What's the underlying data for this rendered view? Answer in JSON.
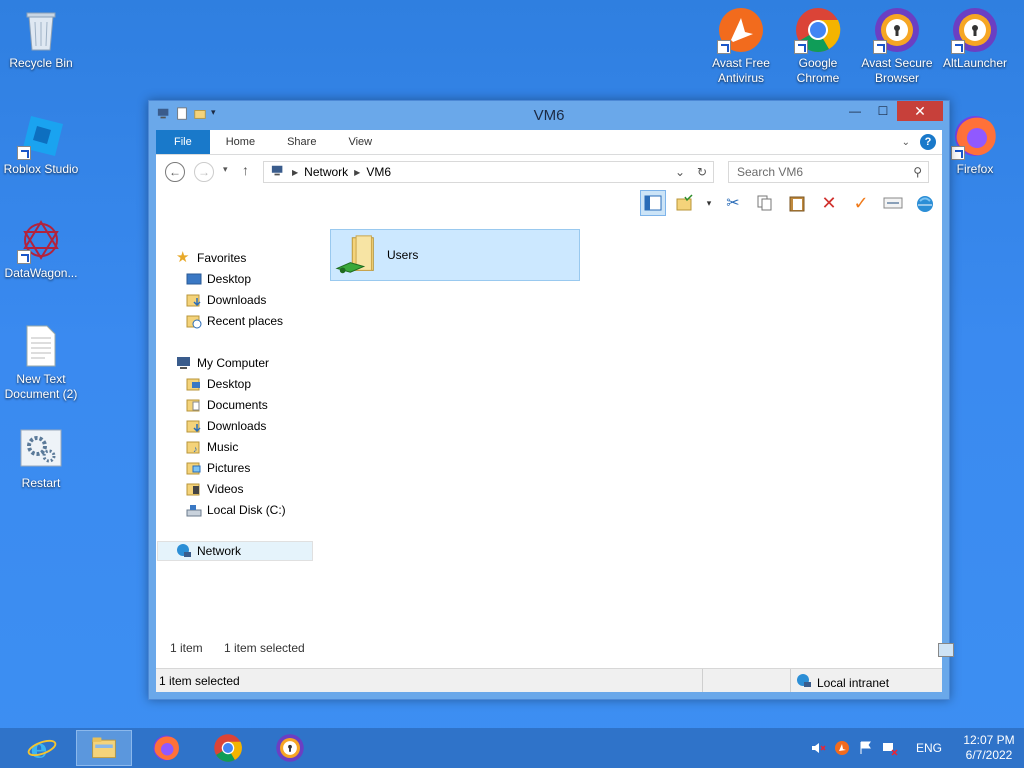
{
  "desktop": {
    "icons_left": [
      {
        "label": "Recycle Bin"
      },
      {
        "label": "Roblox Studio"
      },
      {
        "label": "DataWagon..."
      },
      {
        "label": "New Text Document (2)"
      },
      {
        "label": "Restart"
      }
    ],
    "icons_right": [
      {
        "label": "Avast Free Antivirus"
      },
      {
        "label": "Google Chrome"
      },
      {
        "label": "Avast Secure Browser"
      },
      {
        "label": "AltLauncher"
      },
      {
        "label": "Firefox"
      }
    ]
  },
  "window": {
    "title": "VM6",
    "tabs": [
      "File",
      "Home",
      "Share",
      "View"
    ],
    "address": {
      "crumbs": [
        "Network",
        "VM6"
      ]
    },
    "search_placeholder": "Search VM6",
    "nav": {
      "favorites_label": "Favorites",
      "favorites": [
        "Desktop",
        "Downloads",
        "Recent places"
      ],
      "computer_label": "My Computer",
      "computer": [
        "Desktop",
        "Documents",
        "Downloads",
        "Music",
        "Pictures",
        "Videos",
        "Local Disk (C:)"
      ],
      "network_label": "Network"
    },
    "items": [
      {
        "name": "Users"
      }
    ],
    "status_count": "1 item",
    "status_selected": "1 item selected",
    "statusbar_text": "1 item selected",
    "zone": "Local intranet"
  },
  "taskbar": {
    "lang": "ENG",
    "time": "12:07 PM",
    "date": "6/7/2022"
  },
  "colors": {
    "desktop": "#3a8af0",
    "window_frame": "#6aa8ea",
    "file_tab": "#1979ca",
    "selection": "#cce8ff",
    "taskbar": "#2f73c9",
    "close_button": "#c7403a"
  }
}
